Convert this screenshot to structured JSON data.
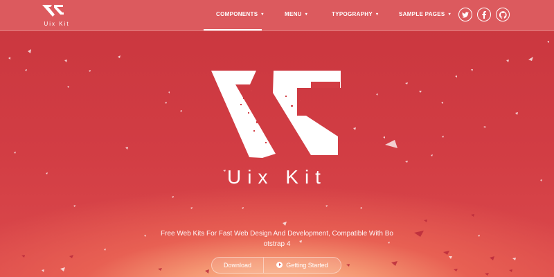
{
  "brand": {
    "name": "Uix Kit",
    "logo_icon": "uix-logo-icon"
  },
  "nav": {
    "items": [
      {
        "label": "COMPONENTS",
        "active": true
      },
      {
        "label": "MENU",
        "active": false
      },
      {
        "label": "TYPOGRAPHY",
        "active": false
      },
      {
        "label": "SAMPLE PAGES",
        "active": false
      }
    ],
    "caret": "▾",
    "social": [
      "twitter-icon",
      "facebook-icon",
      "github-icon"
    ]
  },
  "hero": {
    "title": "Uix Kit",
    "subtitle": "Free Web Kits For Fast Web Design And Development, Compatible With Bootstrap 4",
    "buttons": {
      "download": "Download",
      "start": "Getting Started"
    }
  },
  "colors": {
    "background": "#cc3a42",
    "glow": "#fbc39a",
    "text": "#ffffff"
  }
}
